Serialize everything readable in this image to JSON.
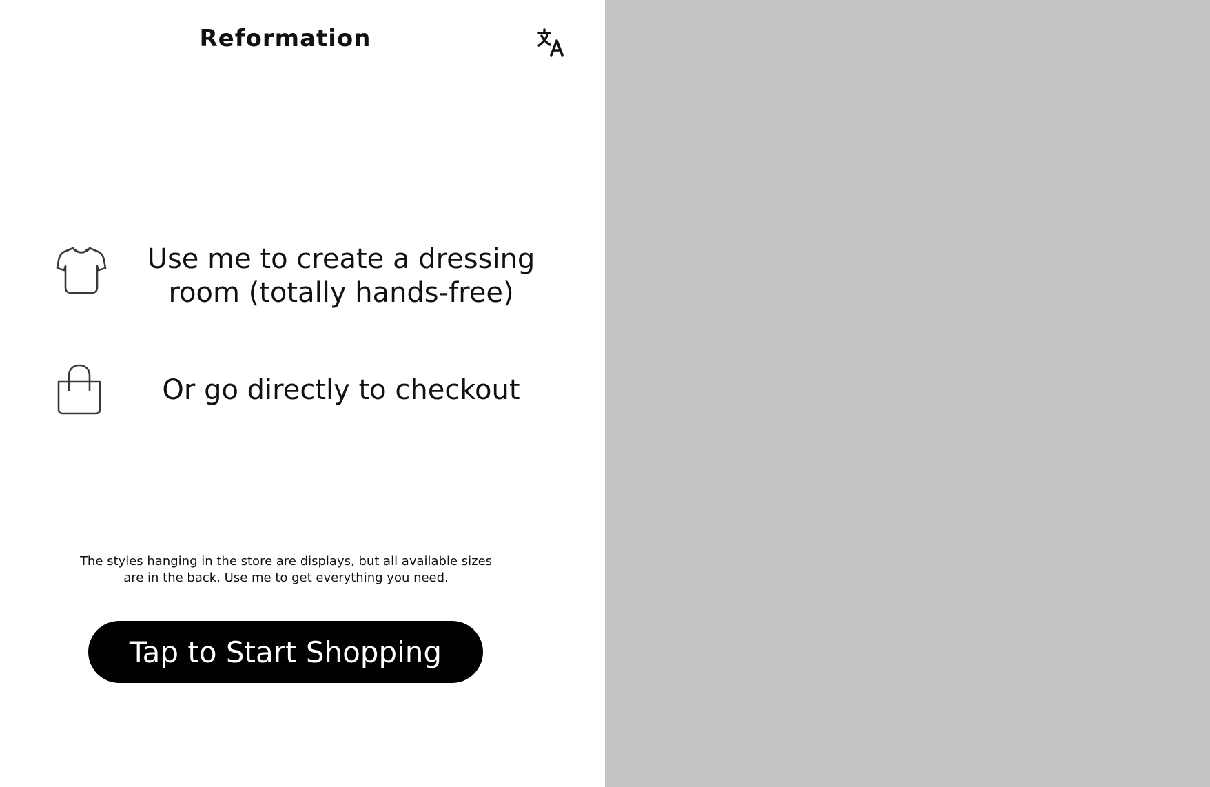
{
  "header": {
    "brand": "Reformation",
    "translate_icon": "translate-icon"
  },
  "features": [
    {
      "icon": "tshirt-icon",
      "text": "Use me to create a dressing room (totally hands-free)"
    },
    {
      "icon": "shopping-bag-icon",
      "text": "Or go directly to checkout"
    }
  ],
  "disclaimer": "The styles hanging in the store are displays, but all available sizes are in the back. Use me to get everything you need.",
  "cta": {
    "label": "Tap to Start Shopping"
  },
  "colors": {
    "background": "#ffffff",
    "right_panel": "#c4c4c4",
    "button_bg": "#000000",
    "button_text": "#ffffff",
    "icon_stroke": "#333a40"
  }
}
